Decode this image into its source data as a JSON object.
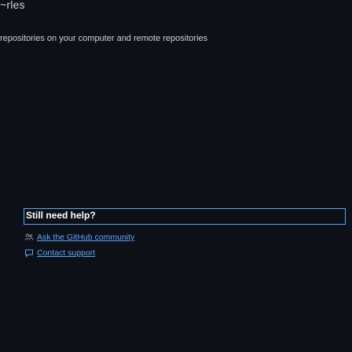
{
  "header": {
    "fragment": "~rles"
  },
  "intro": {
    "text": "repositories on your computer and remote repositories"
  },
  "help": {
    "title": "Still need help?",
    "links": [
      {
        "label": "Ask the GitHub community",
        "icon": "people-icon"
      },
      {
        "label": "Contact support",
        "icon": "comment-icon"
      }
    ]
  },
  "colors": {
    "background": "#0d1117",
    "text": "#c9d1d9",
    "link": "#58a6ff",
    "focus_border": "#58a6ff"
  }
}
